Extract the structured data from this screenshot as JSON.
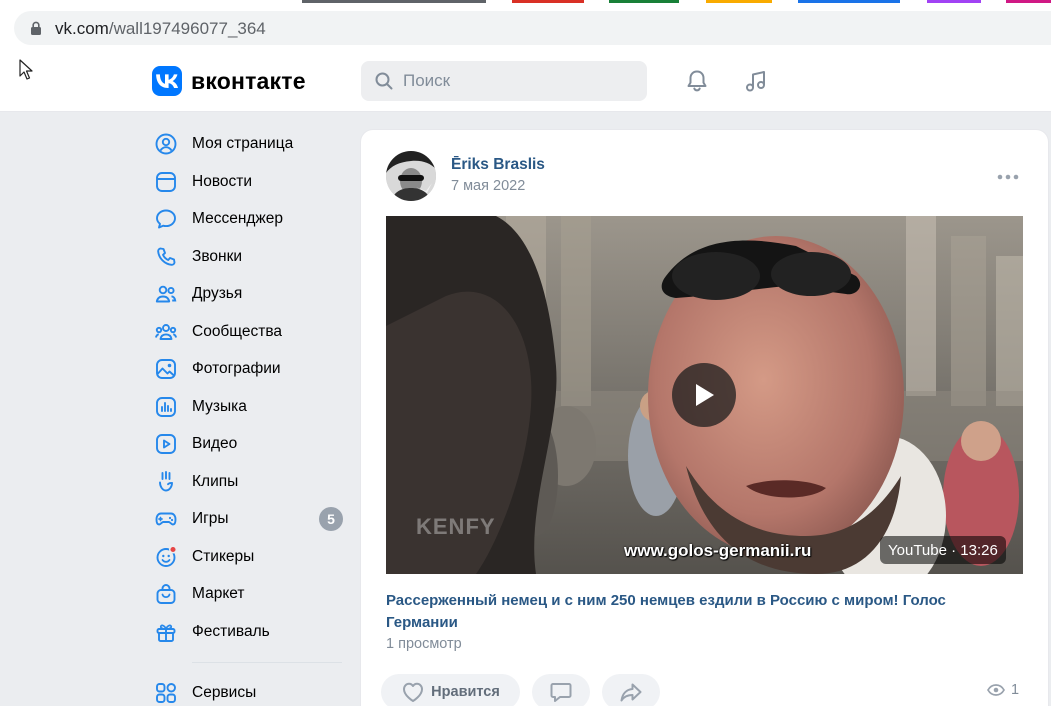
{
  "browser": {
    "url_host": "vk.com",
    "url_path": "/wall197496077_364"
  },
  "header": {
    "logo_text": "вконтакте",
    "search_placeholder": "Поиск"
  },
  "sidebar": {
    "items": [
      {
        "label": "Моя страница",
        "icon": "profile-icon"
      },
      {
        "label": "Новости",
        "icon": "news-icon"
      },
      {
        "label": "Мессенджер",
        "icon": "message-icon"
      },
      {
        "label": "Звонки",
        "icon": "phone-icon"
      },
      {
        "label": "Друзья",
        "icon": "friends-icon"
      },
      {
        "label": "Сообщества",
        "icon": "communities-icon"
      },
      {
        "label": "Фотографии",
        "icon": "photos-icon"
      },
      {
        "label": "Музыка",
        "icon": "music-icon"
      },
      {
        "label": "Видео",
        "icon": "video-icon"
      },
      {
        "label": "Клипы",
        "icon": "clips-icon"
      },
      {
        "label": "Игры",
        "icon": "games-icon",
        "badge": "5"
      },
      {
        "label": "Стикеры",
        "icon": "stickers-icon"
      },
      {
        "label": "Маркет",
        "icon": "market-icon"
      },
      {
        "label": "Фестиваль",
        "icon": "festival-icon"
      }
    ],
    "services_label": "Сервисы"
  },
  "post": {
    "author": "Ēriks Braslis",
    "date": "7 мая 2022",
    "video": {
      "watermark": "www.golos-germanii.ru",
      "channel_mark": "KENFY",
      "duration_badge": "YouTube · 13:26",
      "title": "Рассерженный немец и с ним 250 немцев ездили в Россию с миром! Голос Германии",
      "views_text": "1 просмотр"
    },
    "actions": {
      "like_label": "Нравится"
    },
    "view_count": "1"
  },
  "colors": {
    "accent": "#0077ff",
    "link": "#2a5885",
    "secondary_text": "#818c99",
    "icon_blue": "#2688eb"
  }
}
